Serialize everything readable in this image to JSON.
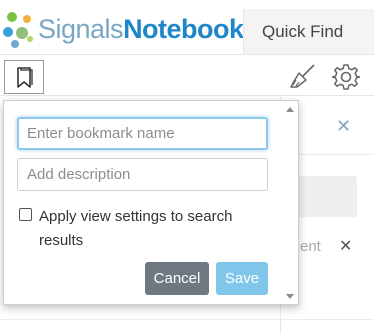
{
  "header": {
    "logo": {
      "part1": "Signals",
      "part2": "Notebook"
    },
    "quick_find_label": "Quick Find"
  },
  "toolbar": {
    "bookmark_icon": "bookmark-icon",
    "broom_icon": "broom-icon",
    "settings_icon": "gear-icon"
  },
  "background": {
    "partial_text": "ent",
    "close_glyph": "✕"
  },
  "bookmark_popup": {
    "name_placeholder": "Enter bookmark name",
    "name_value": "",
    "description_placeholder": "Add description",
    "description_value": "",
    "apply_view_settings_label": "Apply view settings to search results",
    "apply_view_settings_checked": false,
    "cancel_label": "Cancel",
    "save_label": "Save"
  },
  "colors": {
    "brand_blue": "#1f86c8",
    "brand_light": "#7aa6c4",
    "save_button": "#7fc6ea",
    "cancel_button": "#6f7880",
    "focus_border": "#8ec9ec"
  }
}
